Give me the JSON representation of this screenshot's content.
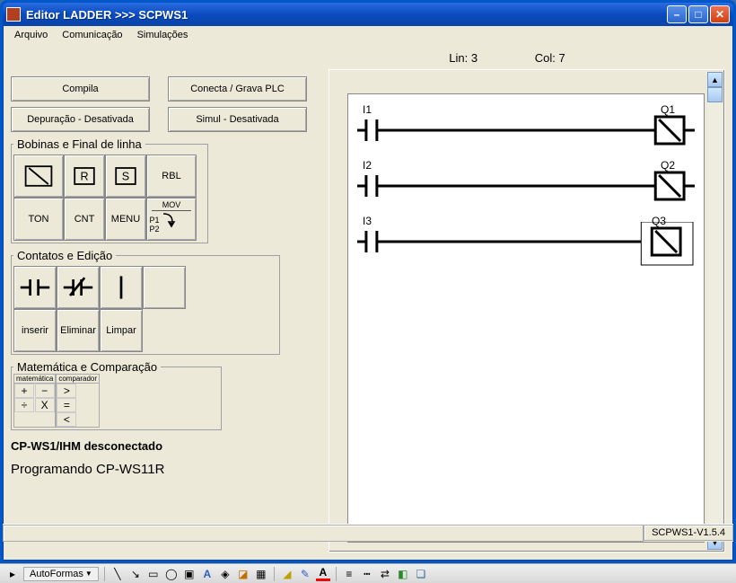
{
  "window": {
    "title": "Editor LADDER >>> SCPWS1"
  },
  "menubar": [
    "Arquivo",
    "Comunicação",
    "Simulações"
  ],
  "status": {
    "lin_label": "Lin:",
    "lin_val": "3",
    "col_label": "Col:",
    "col_val": "7"
  },
  "buttons": {
    "compile": "Compila",
    "connect": "Conecta / Grava PLC",
    "debug": "Depuração - Desativada",
    "sim": "Simul - Desativada"
  },
  "palettes": {
    "bfl": {
      "legend": "Bobinas e Final de linha",
      "cells": [
        "",
        "R",
        "S",
        "RBL",
        "TON",
        "CNT",
        "MENU",
        "MOV"
      ]
    },
    "ce": {
      "legend": "Contatos e Edição",
      "row2": [
        "inserir",
        "Eliminar",
        "Limpar"
      ]
    },
    "math": {
      "legend": "Matemática e Comparação",
      "sub1": "matemática",
      "sub2": "comparador",
      "ops": [
        "+",
        "−",
        "÷",
        "X"
      ],
      "cmp": [
        ">",
        "=",
        "<"
      ]
    }
  },
  "info": {
    "conn": "CP-WS1/IHM desconectado",
    "prog": "Programando CP-WS11R"
  },
  "rungs": [
    {
      "in": "I1",
      "out": "Q1",
      "selected": false
    },
    {
      "in": "I2",
      "out": "Q2",
      "selected": false
    },
    {
      "in": "I3",
      "out": "Q3",
      "selected": true
    }
  ],
  "statusbar": {
    "version": "SCPWS1-V1.5.4"
  },
  "taskbar": {
    "autoshapes": "AutoFormas"
  },
  "mov": {
    "p1": "P1",
    "p2": "P2"
  }
}
